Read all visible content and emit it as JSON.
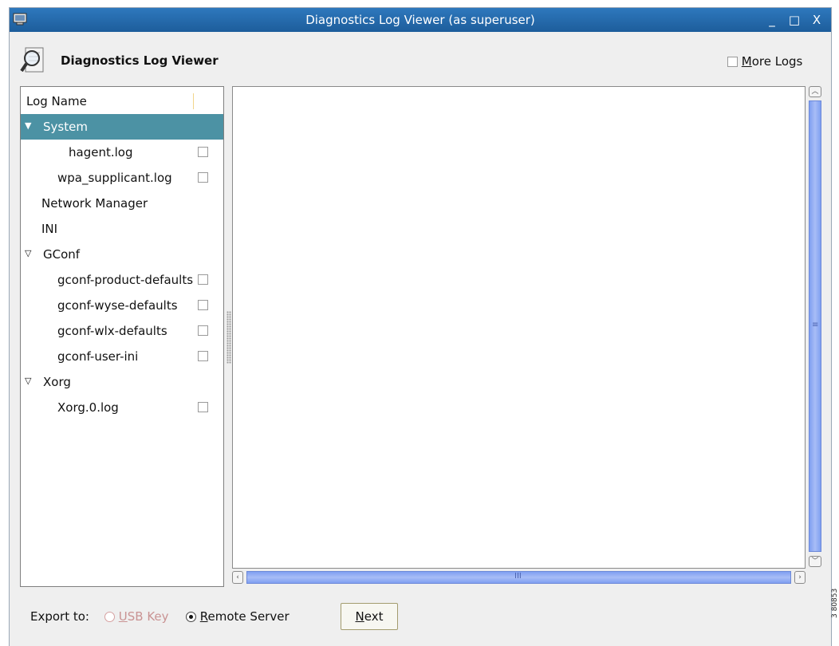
{
  "window": {
    "title": "Diagnostics Log Viewer (as superuser)",
    "controls": [
      "_",
      "□",
      "X"
    ]
  },
  "header": {
    "title": "Diagnostics Log Viewer",
    "more_logs_prefix": "M",
    "more_logs_rest": "ore Logs",
    "more_logs_checked": false
  },
  "tree": {
    "column_header": "Log Name",
    "rows": [
      {
        "label": "System",
        "type": "group",
        "expanded": true,
        "selected": true
      },
      {
        "label": "hagent.log",
        "type": "file",
        "checked": false
      },
      {
        "label": "wpa_supplicant.log",
        "type": "file",
        "checked": false
      },
      {
        "label": "Network Manager",
        "type": "group",
        "expanded": false
      },
      {
        "label": "INI",
        "type": "group",
        "expanded": false
      },
      {
        "label": "GConf",
        "type": "group",
        "expanded": true
      },
      {
        "label": "gconf-product-defaults",
        "type": "file",
        "checked": false
      },
      {
        "label": "gconf-wyse-defaults",
        "type": "file",
        "checked": false
      },
      {
        "label": "gconf-wlx-defaults",
        "type": "file",
        "checked": false
      },
      {
        "label": "gconf-user-ini",
        "type": "file",
        "checked": false
      },
      {
        "label": "Xorg",
        "type": "group",
        "expanded": true
      },
      {
        "label": "Xorg.0.log",
        "type": "file",
        "checked": false
      }
    ]
  },
  "footer": {
    "export_label": "Export to:",
    "usb_prefix": "U",
    "usb_rest": "SB Key",
    "remote_prefix": "R",
    "remote_rest": "emote Server",
    "selected": "Remote Server",
    "next_prefix": "N",
    "next_rest": "ext"
  },
  "side_label": "3 80853"
}
